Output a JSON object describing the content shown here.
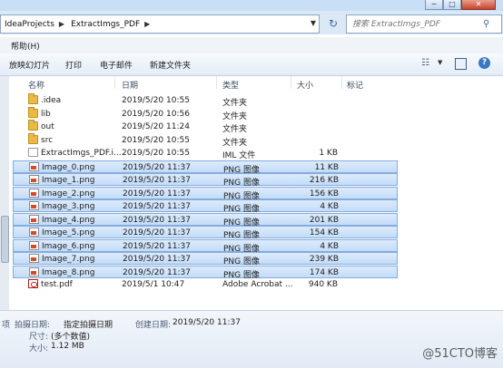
{
  "window": {
    "minimize": "─",
    "maximize": "□",
    "close": "✕"
  },
  "address": {
    "crumbs": [
      "IdeaProjects",
      "ExtractImgs_PDF"
    ],
    "separator": "▶"
  },
  "search": {
    "placeholder": "搜索 ExtractImgs_PDF"
  },
  "menu": {
    "help": "帮助(H)"
  },
  "toolbar": {
    "slideshow": "放映幻灯片",
    "print": "打印",
    "email": "电子邮件",
    "new_folder": "新建文件夹"
  },
  "columns": {
    "name": "名称",
    "date": "日期",
    "type": "类型",
    "size": "大小",
    "tags": "标记"
  },
  "files": [
    {
      "name": ".idea",
      "date": "2019/5/20 10:55",
      "type": "文件夹",
      "size": "",
      "icon": "folder",
      "selected": false
    },
    {
      "name": "lib",
      "date": "2019/5/20 10:56",
      "type": "文件夹",
      "size": "",
      "icon": "folder",
      "selected": false
    },
    {
      "name": "out",
      "date": "2019/5/20 11:24",
      "type": "文件夹",
      "size": "",
      "icon": "folder",
      "selected": false
    },
    {
      "name": "src",
      "date": "2019/5/20 10:55",
      "type": "文件夹",
      "size": "",
      "icon": "folder",
      "selected": false
    },
    {
      "name": "ExtractImgs_PDF.i...",
      "date": "2019/5/20 10:55",
      "type": "IML 文件",
      "size": "1 KB",
      "icon": "iml",
      "selected": false
    },
    {
      "name": "Image_0.png",
      "date": "2019/5/20 11:37",
      "type": "PNG 图像",
      "size": "11 KB",
      "icon": "image",
      "selected": true
    },
    {
      "name": "Image_1.png",
      "date": "2019/5/20 11:37",
      "type": "PNG 图像",
      "size": "216 KB",
      "icon": "image",
      "selected": true
    },
    {
      "name": "Image_2.png",
      "date": "2019/5/20 11:37",
      "type": "PNG 图像",
      "size": "156 KB",
      "icon": "image",
      "selected": true
    },
    {
      "name": "Image_3.png",
      "date": "2019/5/20 11:37",
      "type": "PNG 图像",
      "size": "4 KB",
      "icon": "image",
      "selected": true
    },
    {
      "name": "Image_4.png",
      "date": "2019/5/20 11:37",
      "type": "PNG 图像",
      "size": "201 KB",
      "icon": "image",
      "selected": true
    },
    {
      "name": "Image_5.png",
      "date": "2019/5/20 11:37",
      "type": "PNG 图像",
      "size": "154 KB",
      "icon": "image",
      "selected": true
    },
    {
      "name": "Image_6.png",
      "date": "2019/5/20 11:37",
      "type": "PNG 图像",
      "size": "4 KB",
      "icon": "image",
      "selected": true
    },
    {
      "name": "Image_7.png",
      "date": "2019/5/20 11:37",
      "type": "PNG 图像",
      "size": "239 KB",
      "icon": "image",
      "selected": true
    },
    {
      "name": "Image_8.png",
      "date": "2019/5/20 11:37",
      "type": "PNG 图像",
      "size": "174 KB",
      "icon": "image",
      "selected": true
    },
    {
      "name": "test.pdf",
      "date": "2019/5/1 10:47",
      "type": "Adobe Acrobat ...",
      "size": "940 KB",
      "icon": "pdf",
      "selected": false
    }
  ],
  "details": {
    "count_suffix": "项",
    "date_taken_label": "拍摄日期:",
    "date_taken_value": "指定拍摄日期",
    "created_label": "创建日期:",
    "created_value": "2019/5/20 11:37",
    "dimensions_label": "尺寸:",
    "dimensions_value": "(多个数值)",
    "size_label": "大小:",
    "size_value": "1.12 MB"
  },
  "watermark": "@51CTO博客"
}
